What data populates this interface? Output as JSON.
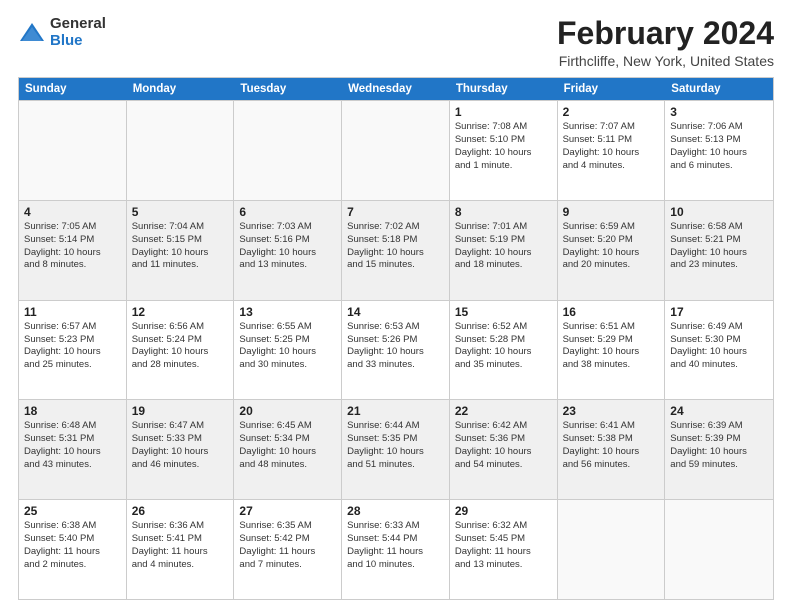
{
  "logo": {
    "general": "General",
    "blue": "Blue"
  },
  "title": "February 2024",
  "subtitle": "Firthcliffe, New York, United States",
  "header_days": [
    "Sunday",
    "Monday",
    "Tuesday",
    "Wednesday",
    "Thursday",
    "Friday",
    "Saturday"
  ],
  "weeks": [
    [
      {
        "day": "",
        "info": "",
        "empty": true
      },
      {
        "day": "",
        "info": "",
        "empty": true
      },
      {
        "day": "",
        "info": "",
        "empty": true
      },
      {
        "day": "",
        "info": "",
        "empty": true
      },
      {
        "day": "1",
        "info": "Sunrise: 7:08 AM\nSunset: 5:10 PM\nDaylight: 10 hours\nand 1 minute."
      },
      {
        "day": "2",
        "info": "Sunrise: 7:07 AM\nSunset: 5:11 PM\nDaylight: 10 hours\nand 4 minutes."
      },
      {
        "day": "3",
        "info": "Sunrise: 7:06 AM\nSunset: 5:13 PM\nDaylight: 10 hours\nand 6 minutes."
      }
    ],
    [
      {
        "day": "4",
        "info": "Sunrise: 7:05 AM\nSunset: 5:14 PM\nDaylight: 10 hours\nand 8 minutes."
      },
      {
        "day": "5",
        "info": "Sunrise: 7:04 AM\nSunset: 5:15 PM\nDaylight: 10 hours\nand 11 minutes."
      },
      {
        "day": "6",
        "info": "Sunrise: 7:03 AM\nSunset: 5:16 PM\nDaylight: 10 hours\nand 13 minutes."
      },
      {
        "day": "7",
        "info": "Sunrise: 7:02 AM\nSunset: 5:18 PM\nDaylight: 10 hours\nand 15 minutes."
      },
      {
        "day": "8",
        "info": "Sunrise: 7:01 AM\nSunset: 5:19 PM\nDaylight: 10 hours\nand 18 minutes."
      },
      {
        "day": "9",
        "info": "Sunrise: 6:59 AM\nSunset: 5:20 PM\nDaylight: 10 hours\nand 20 minutes."
      },
      {
        "day": "10",
        "info": "Sunrise: 6:58 AM\nSunset: 5:21 PM\nDaylight: 10 hours\nand 23 minutes."
      }
    ],
    [
      {
        "day": "11",
        "info": "Sunrise: 6:57 AM\nSunset: 5:23 PM\nDaylight: 10 hours\nand 25 minutes."
      },
      {
        "day": "12",
        "info": "Sunrise: 6:56 AM\nSunset: 5:24 PM\nDaylight: 10 hours\nand 28 minutes."
      },
      {
        "day": "13",
        "info": "Sunrise: 6:55 AM\nSunset: 5:25 PM\nDaylight: 10 hours\nand 30 minutes."
      },
      {
        "day": "14",
        "info": "Sunrise: 6:53 AM\nSunset: 5:26 PM\nDaylight: 10 hours\nand 33 minutes."
      },
      {
        "day": "15",
        "info": "Sunrise: 6:52 AM\nSunset: 5:28 PM\nDaylight: 10 hours\nand 35 minutes."
      },
      {
        "day": "16",
        "info": "Sunrise: 6:51 AM\nSunset: 5:29 PM\nDaylight: 10 hours\nand 38 minutes."
      },
      {
        "day": "17",
        "info": "Sunrise: 6:49 AM\nSunset: 5:30 PM\nDaylight: 10 hours\nand 40 minutes."
      }
    ],
    [
      {
        "day": "18",
        "info": "Sunrise: 6:48 AM\nSunset: 5:31 PM\nDaylight: 10 hours\nand 43 minutes."
      },
      {
        "day": "19",
        "info": "Sunrise: 6:47 AM\nSunset: 5:33 PM\nDaylight: 10 hours\nand 46 minutes."
      },
      {
        "day": "20",
        "info": "Sunrise: 6:45 AM\nSunset: 5:34 PM\nDaylight: 10 hours\nand 48 minutes."
      },
      {
        "day": "21",
        "info": "Sunrise: 6:44 AM\nSunset: 5:35 PM\nDaylight: 10 hours\nand 51 minutes."
      },
      {
        "day": "22",
        "info": "Sunrise: 6:42 AM\nSunset: 5:36 PM\nDaylight: 10 hours\nand 54 minutes."
      },
      {
        "day": "23",
        "info": "Sunrise: 6:41 AM\nSunset: 5:38 PM\nDaylight: 10 hours\nand 56 minutes."
      },
      {
        "day": "24",
        "info": "Sunrise: 6:39 AM\nSunset: 5:39 PM\nDaylight: 10 hours\nand 59 minutes."
      }
    ],
    [
      {
        "day": "25",
        "info": "Sunrise: 6:38 AM\nSunset: 5:40 PM\nDaylight: 11 hours\nand 2 minutes."
      },
      {
        "day": "26",
        "info": "Sunrise: 6:36 AM\nSunset: 5:41 PM\nDaylight: 11 hours\nand 4 minutes."
      },
      {
        "day": "27",
        "info": "Sunrise: 6:35 AM\nSunset: 5:42 PM\nDaylight: 11 hours\nand 7 minutes."
      },
      {
        "day": "28",
        "info": "Sunrise: 6:33 AM\nSunset: 5:44 PM\nDaylight: 11 hours\nand 10 minutes."
      },
      {
        "day": "29",
        "info": "Sunrise: 6:32 AM\nSunset: 5:45 PM\nDaylight: 11 hours\nand 13 minutes."
      },
      {
        "day": "",
        "info": "",
        "empty": true
      },
      {
        "day": "",
        "info": "",
        "empty": true
      }
    ]
  ]
}
